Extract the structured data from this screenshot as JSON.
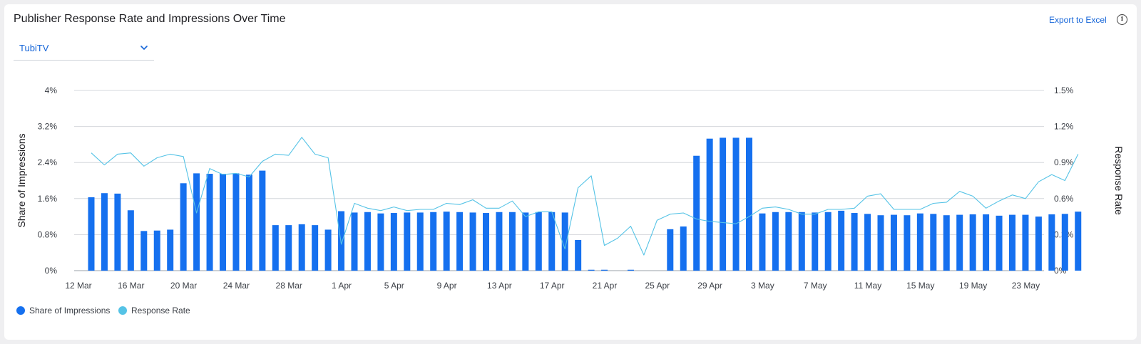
{
  "header": {
    "title": "Publisher Response Rate and Impressions Over Time",
    "export_label": "Export to Excel",
    "info_icon": "info-icon"
  },
  "filter": {
    "selected": "TubiTV",
    "icon": "chevron-down-icon"
  },
  "colors": {
    "bar": "#1570ef",
    "line": "#55c3e6",
    "link": "#1565d8"
  },
  "chart_data": {
    "type": "bar",
    "x_tick_labels": [
      "12 Mar",
      "16 Mar",
      "20 Mar",
      "24 Mar",
      "28 Mar",
      "1 Apr",
      "5 Apr",
      "9 Apr",
      "13 Apr",
      "17 Apr",
      "21 Apr",
      "25 Apr",
      "29 Apr",
      "3 May",
      "7 May",
      "11 May",
      "15 May",
      "19 May",
      "23 May"
    ],
    "y_left": {
      "label": "Share of Impressions",
      "ticks": [
        "0%",
        "0.8%",
        "1.6%",
        "2.4%",
        "3.2%",
        "4%"
      ],
      "range": [
        0,
        4
      ]
    },
    "y_right": {
      "label": "Response Rate",
      "ticks": [
        "0%",
        "0.3%",
        "0.6%",
        "0.9%",
        "1.2%",
        "1.5%"
      ],
      "range": [
        0,
        1.5
      ]
    },
    "grid": true,
    "legend_position": "bottom-left",
    "series": [
      {
        "name": "Share of Impressions",
        "kind": "bar",
        "axis": "left",
        "values": [
          1.63,
          1.72,
          1.71,
          1.34,
          0.88,
          0.89,
          0.91,
          1.94,
          2.16,
          2.15,
          2.15,
          2.16,
          2.13,
          2.22,
          1.01,
          1.01,
          1.03,
          1.01,
          0.91,
          1.32,
          1.29,
          1.3,
          1.27,
          1.28,
          1.29,
          1.29,
          1.3,
          1.31,
          1.3,
          1.29,
          1.28,
          1.3,
          1.3,
          1.29,
          1.3,
          1.3,
          1.29,
          0.68,
          0.02,
          0.02,
          0,
          0.02,
          0,
          0,
          0.92,
          0.98,
          2.55,
          2.93,
          2.95,
          2.95,
          2.95,
          1.27,
          1.3,
          1.3,
          1.3,
          1.29,
          1.3,
          1.33,
          1.28,
          1.26,
          1.23,
          1.24,
          1.23,
          1.27,
          1.26,
          1.23,
          1.24,
          1.25,
          1.25,
          1.22,
          1.24,
          1.24,
          1.2,
          1.25,
          1.26,
          1.31
        ]
      },
      {
        "name": "Response Rate",
        "kind": "line",
        "axis": "right",
        "values": [
          0.98,
          0.88,
          0.97,
          0.98,
          0.87,
          0.94,
          0.97,
          0.95,
          0.48,
          0.85,
          0.8,
          0.81,
          0.78,
          0.91,
          0.97,
          0.96,
          1.11,
          0.97,
          0.94,
          0.22,
          0.56,
          0.52,
          0.5,
          0.53,
          0.5,
          0.51,
          0.51,
          0.56,
          0.55,
          0.59,
          0.52,
          0.52,
          0.58,
          0.45,
          0.49,
          0.49,
          0.18,
          0.69,
          0.79,
          0.21,
          0.27,
          0.37,
          0.13,
          0.42,
          0.47,
          0.48,
          0.43,
          0.41,
          0.4,
          0.39,
          0.45,
          0.52,
          0.53,
          0.51,
          0.47,
          0.47,
          0.51,
          0.51,
          0.52,
          0.62,
          0.64,
          0.51,
          0.51,
          0.51,
          0.56,
          0.57,
          0.66,
          0.62,
          0.52,
          0.58,
          0.63,
          0.6,
          0.74,
          0.8,
          0.75,
          0.97
        ]
      }
    ]
  }
}
